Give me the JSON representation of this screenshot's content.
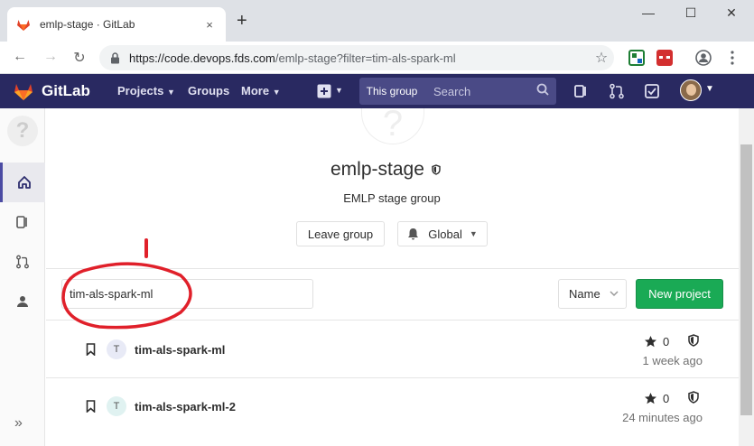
{
  "browser": {
    "tab_title": "emlp-stage · GitLab",
    "tab_close": "×",
    "new_tab": "+",
    "window_controls": {
      "minimize": "—",
      "maximize": "☐",
      "close": "✕"
    },
    "url_host": "https://code.devops.fds.com",
    "url_path": "/emlp-stage?filter=tim-als-spark-ml",
    "nav": {
      "back": "←",
      "forward": "→",
      "reload": "↻"
    },
    "bookmark_icon": "☆"
  },
  "gitlab_nav": {
    "brand": "GitLab",
    "menus": [
      "Projects",
      "Groups",
      "More"
    ],
    "scope_label": "This group",
    "search_placeholder": "Search"
  },
  "group": {
    "avatar_glyph": "?",
    "name": "emlp-stage",
    "description": "EMLP stage group",
    "leave_label": "Leave group",
    "notification_label": "Global"
  },
  "filter": {
    "value": "tim-als-spark-ml",
    "sort_label": "Name",
    "new_project_label": "New project"
  },
  "projects": [
    {
      "initial": "T",
      "name": "tim-als-spark-ml",
      "stars": "0",
      "updated": "1 week ago",
      "avatar_color": "#e8eaf6"
    },
    {
      "initial": "T",
      "name": "tim-als-spark-ml-2",
      "stars": "0",
      "updated": "24 minutes ago",
      "avatar_color": "#e0f2f1"
    }
  ],
  "colors": {
    "nav_bg": "#292961",
    "accent": "#1aaa55",
    "annotation": "#e0202a"
  },
  "sidebar": {
    "collapse_glyph": "»"
  }
}
